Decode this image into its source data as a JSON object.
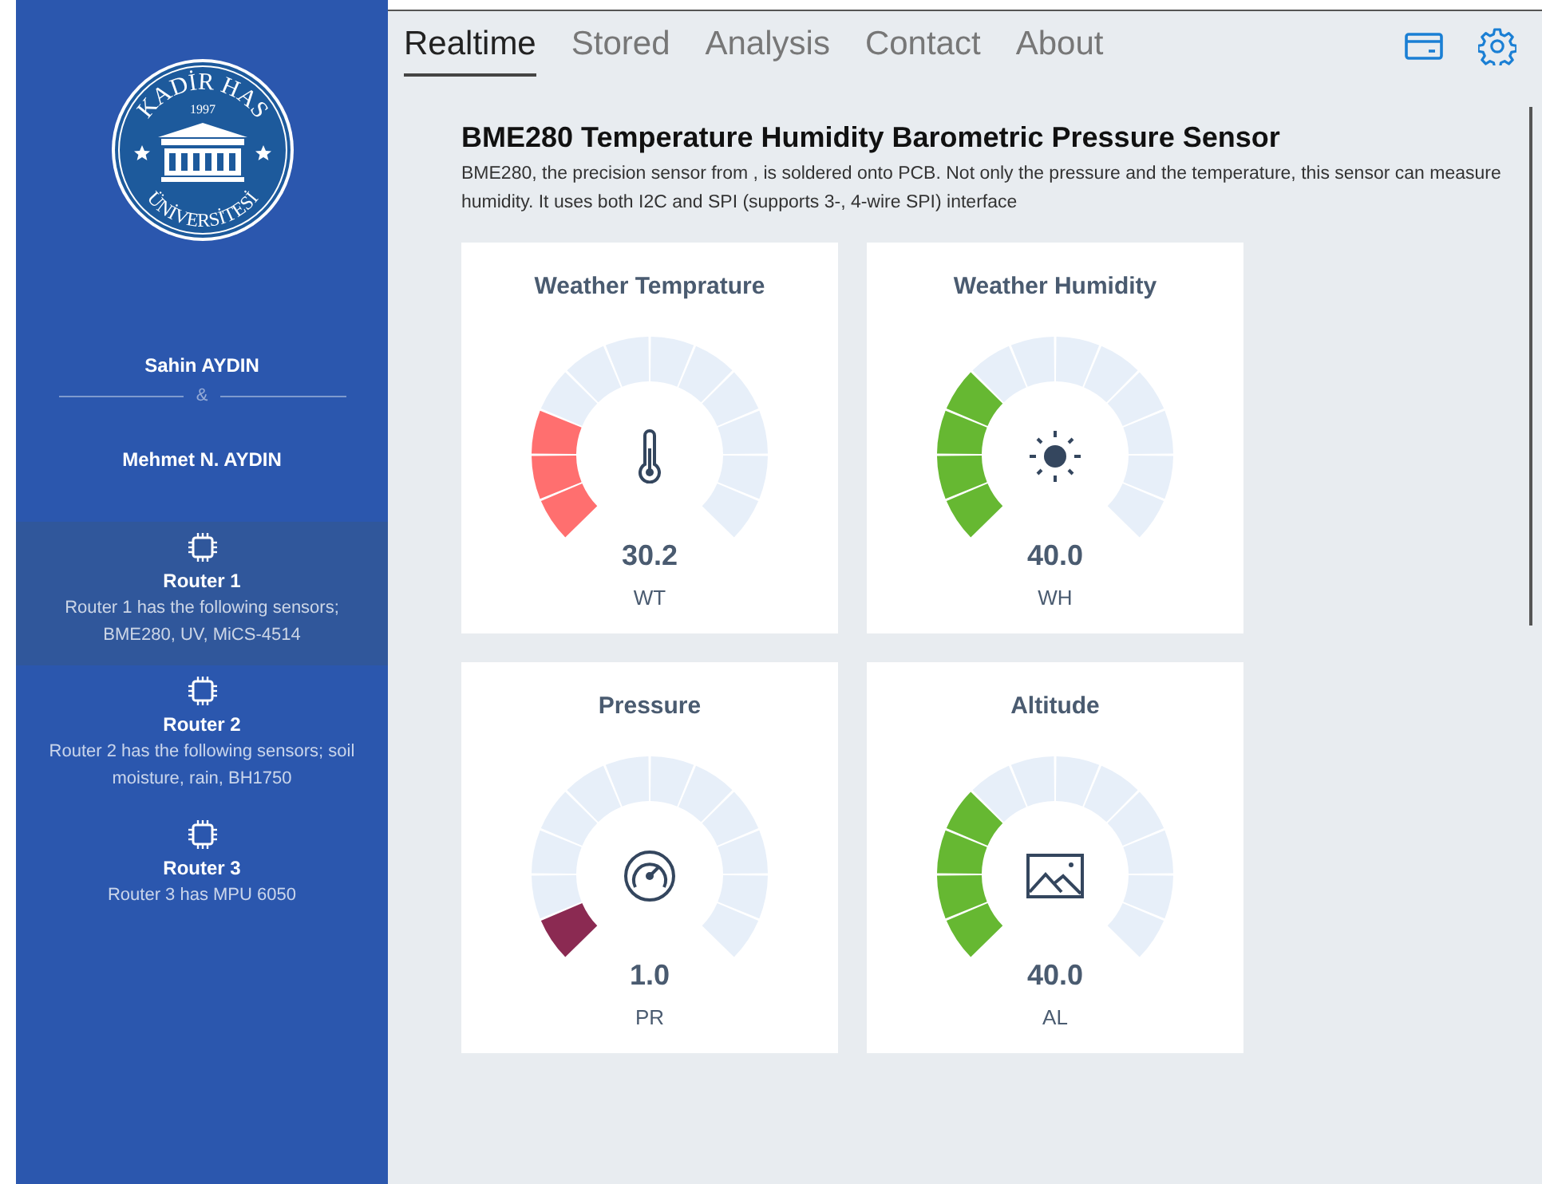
{
  "logo": {
    "top": "KADİR HAS",
    "year": "1997",
    "bottom": "ÜNİVERSİTESİ"
  },
  "authors": {
    "first": "Sahin AYDIN",
    "separator": "&",
    "second": "Mehmet N. AYDIN"
  },
  "routers": [
    {
      "name": "Router 1",
      "description": "Router 1 has the following sensors; BME280, UV, MiCS-4514",
      "selected": true
    },
    {
      "name": "Router 2",
      "description": "Router 2 has the following sensors; soil moisture, rain, BH1750",
      "selected": false
    },
    {
      "name": "Router 3",
      "description": "Router 3 has MPU 6050",
      "selected": false
    }
  ],
  "tabs": [
    {
      "label": "Realtime",
      "selected": true
    },
    {
      "label": "Stored",
      "selected": false
    },
    {
      "label": "Analysis",
      "selected": false
    },
    {
      "label": "Contact",
      "selected": false
    },
    {
      "label": "About",
      "selected": false
    }
  ],
  "sensor": {
    "title": "BME280 Temperature Humidity Barometric Pressure Sensor",
    "description": "BME280, the precision sensor from , is soldered onto PCB. Not only the pressure and the temperature, this sensor can measure humidity. It uses both I2C and SPI (supports 3-, 4-wire SPI) interface"
  },
  "gauges": [
    {
      "title": "Weather Temprature",
      "kind": "temperature",
      "color": "#ff6f6f",
      "value": "30.2",
      "unit": "WT"
    },
    {
      "title": "Weather Humidity",
      "kind": "humidity",
      "color": "#66b832",
      "value": "40.0",
      "unit": "WH"
    },
    {
      "title": "Pressure",
      "kind": "pressure",
      "color": "#8b2a52",
      "value": "1.0",
      "unit": "PR"
    },
    {
      "title": "Altitude",
      "kind": "altitude",
      "color": "#66b832",
      "value": "40.0",
      "unit": "AL"
    }
  ]
}
